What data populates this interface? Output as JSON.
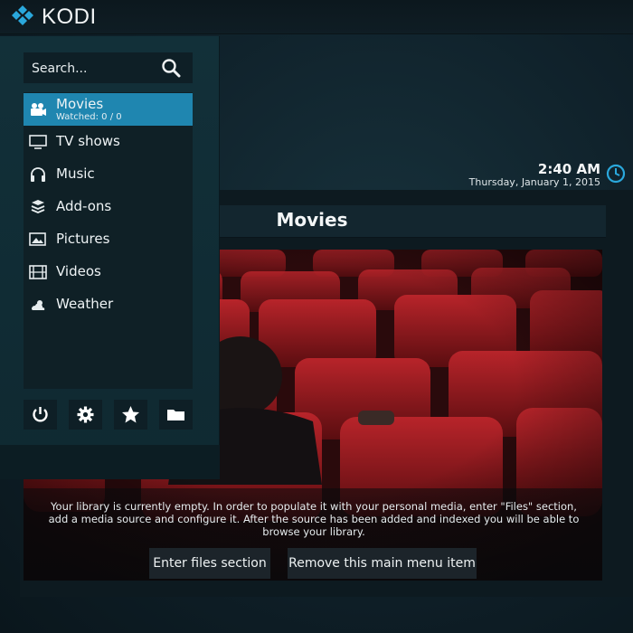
{
  "app": {
    "name": "KODI"
  },
  "clock": {
    "time": "2:40 AM",
    "date": "Thursday, January 1, 2015"
  },
  "search": {
    "label": "Search..."
  },
  "menu": {
    "items": [
      {
        "label": "Movies",
        "sub": "Watched: 0 / 0",
        "icon": "movies-icon",
        "active": true
      },
      {
        "label": "TV shows",
        "icon": "tv-icon"
      },
      {
        "label": "Music",
        "icon": "headphones-icon"
      },
      {
        "label": "Add-ons",
        "icon": "addons-icon"
      },
      {
        "label": "Pictures",
        "icon": "pictures-icon"
      },
      {
        "label": "Videos",
        "icon": "film-icon"
      },
      {
        "label": "Weather",
        "icon": "weather-icon"
      }
    ]
  },
  "bottom_buttons": [
    "power-icon",
    "gear-icon",
    "star-icon",
    "folder-icon"
  ],
  "content": {
    "title": "Movies",
    "message": "Your library is currently empty. In order to populate it with your personal media, enter \"Files\" section, add a media source and configure it. After the source has been added and indexed you will be able to browse your library.",
    "buttons": {
      "files": "Enter files section",
      "remove": "Remove this main menu item"
    }
  },
  "colors": {
    "accent": "#1f86b0",
    "logo_blue": "#2aa8dc"
  }
}
